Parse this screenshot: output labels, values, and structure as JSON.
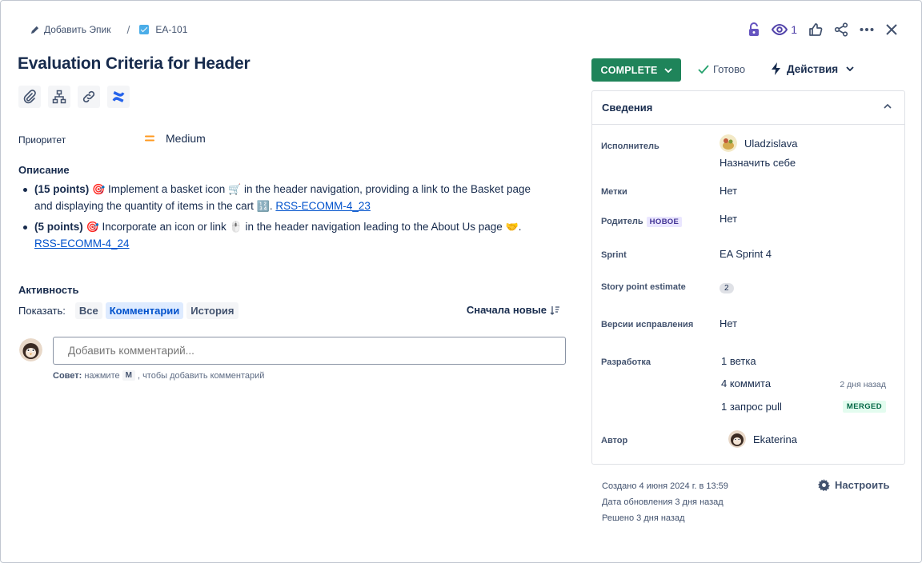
{
  "breadcrumb": {
    "add_epic": "Добавить Эпик",
    "separator": "/",
    "issue_key": "EA-101"
  },
  "top_actions": {
    "watch_count": "1"
  },
  "issue": {
    "title": "Evaluation Criteria for Header"
  },
  "priority": {
    "label": "Приоритет",
    "value": "Medium",
    "color": "#ff991f"
  },
  "description": {
    "title": "Описание",
    "items": [
      {
        "points": "(15 points)",
        "text_a": "Implement a basket icon",
        "text_b": "in the header navigation, providing a link to the Basket page and displaying the quantity of items in the cart",
        "link": "RSS-ECOMM-4_23"
      },
      {
        "points": "(5 points)",
        "text_a": "Incorporate an icon or link",
        "text_b": "in the header navigation leading to the About Us page",
        "link": "RSS-ECOMM-4_24"
      }
    ]
  },
  "activity": {
    "title": "Активность",
    "show_label": "Показать:",
    "filters": [
      "Все",
      "Комментарии",
      "История"
    ],
    "active_filter": "Комментарии",
    "sort_label": "Сначала новые",
    "comment_placeholder": "Добавить комментарий...",
    "tip_prefix": "Совет:",
    "tip_text_1": "нажмите",
    "tip_key": "M",
    "tip_text_2": ", чтобы добавить комментарий"
  },
  "status": {
    "button": "COMPLETE",
    "resolution": "Готово",
    "actions": "Действия",
    "button_color": "#1f845a"
  },
  "details": {
    "title": "Сведения",
    "assignee_label": "Исполнитель",
    "assignee": "Uladzislava",
    "assign_self": "Назначить себе",
    "labels_label": "Метки",
    "labels": "Нет",
    "parent_label": "Родитель",
    "parent_badge": "НОВОЕ",
    "parent": "Нет",
    "sprint_label": "Sprint",
    "sprint": "EA Sprint 4",
    "sp_label": "Story point estimate",
    "sp": "2",
    "fix_label": "Версии исправления",
    "fix": "Нет",
    "dev_label": "Разработка",
    "branch": "1 ветка",
    "commits": "4 коммита",
    "commits_time": "2 дня назад",
    "pr": "1 запрос pull",
    "pr_status": "MERGED",
    "reporter_label": "Автор",
    "reporter": "Ekaterina"
  },
  "meta": {
    "created": "Создано 4 июня 2024 г. в 13:59",
    "updated": "Дата обновления 3 дня назад",
    "resolved": "Решено 3 дня назад",
    "configure": "Настроить"
  }
}
